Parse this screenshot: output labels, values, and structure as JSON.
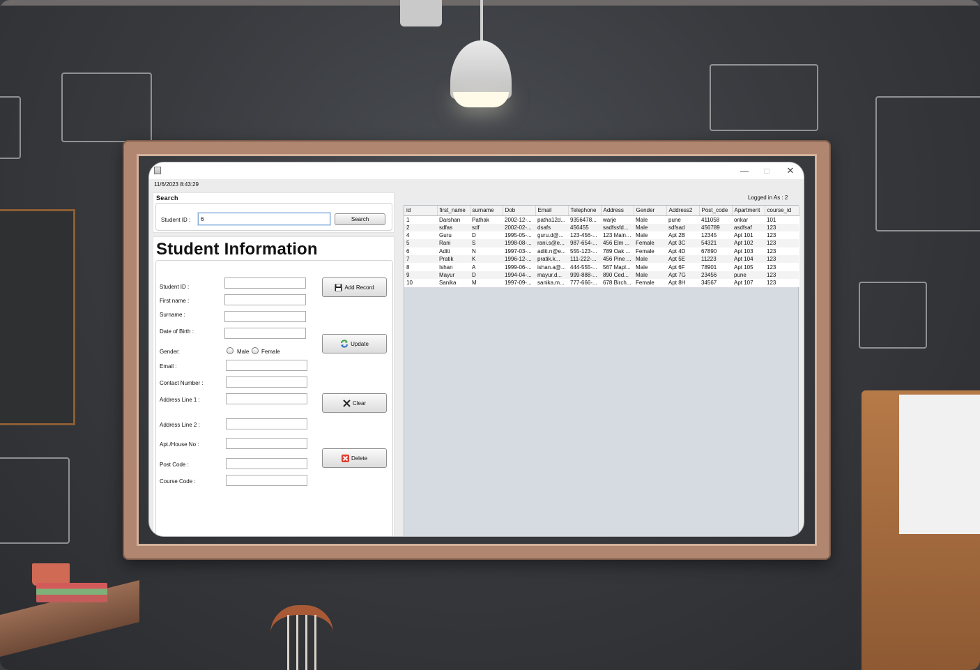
{
  "window": {
    "datetime": "11/6/2023  8:43:29",
    "controls": {
      "minimize": "—",
      "maximize": "□",
      "close": "✕"
    }
  },
  "search": {
    "title": "Search",
    "student_id_label": "Student ID :",
    "student_id_value": "6",
    "button_label": "Search"
  },
  "form": {
    "title": "Student Information",
    "labels": {
      "student_id": "Student ID :",
      "first_name": "First name :",
      "surname": "Surname :",
      "dob": "Date of Birth :",
      "gender": "Gender:",
      "email": "Email :",
      "contact": "Contact Number :",
      "address1": "Address Line 1 :",
      "address2": "Address Line 2 :",
      "apt": "Apt./House No :",
      "post_code": "Post Code :",
      "course_code": "Course Code :"
    },
    "gender_options": {
      "male": "Male",
      "female": "Female"
    },
    "buttons": {
      "add": "Add Record",
      "update": "Update",
      "clear": "Clear",
      "delete": "Delete"
    }
  },
  "status": {
    "logged_in": "Logged in As :  2"
  },
  "table": {
    "columns": [
      "id",
      "first_name",
      "surname",
      "Dob",
      "Email",
      "Telephone",
      "Address",
      "Gender",
      "Address2",
      "Post_code",
      "Apartment",
      "course_id"
    ],
    "rows": [
      [
        "1",
        "Darshan",
        "Pathak",
        "2002-12-...",
        "patha12d...",
        "9356478...",
        "warje",
        "Male",
        "pune",
        "411058",
        "onkar",
        "101"
      ],
      [
        "2",
        "sdfas",
        "sdf",
        "2002-02-...",
        "dsafs",
        "456455",
        "sadfssfd...",
        "Male",
        "sdfsad",
        "456789",
        "asdfsaf",
        "123"
      ],
      [
        "4",
        "Guru",
        "D",
        "1995-05-...",
        "guru.d@...",
        "123-456-...",
        "123 Main ...",
        "Male",
        "Apt 2B",
        "12345",
        "Apt 101",
        "123"
      ],
      [
        "5",
        "Rani",
        "S",
        "1998-08-...",
        "rani.s@e...",
        "987-654-...",
        "456 Elm ...",
        "Female",
        "Apt 3C",
        "54321",
        "Apt 102",
        "123"
      ],
      [
        "6",
        "Aditi",
        "N",
        "1997-03-...",
        "aditi.n@e...",
        "555-123-...",
        "789 Oak ...",
        "Female",
        "Apt 4D",
        "67890",
        "Apt 103",
        "123"
      ],
      [
        "7",
        "Pratik",
        "K",
        "1996-12-...",
        "pratik.k...",
        "111-222-...",
        "456 Pine ...",
        "Male",
        "Apt 5E",
        "11223",
        "Apt 104",
        "123"
      ],
      [
        "8",
        "Ishan",
        "A",
        "1999-06-...",
        "ishan.a@...",
        "444-555-...",
        "567 Mapl...",
        "Male",
        "Apt 6F",
        "78901",
        "Apt 105",
        "123"
      ],
      [
        "9",
        "Mayur",
        "D",
        "1994-04-...",
        "mayur.d...",
        "999-888-...",
        "890 Ced...",
        "Male",
        "Apt 7G",
        "23456",
        "pune",
        "123"
      ],
      [
        "10",
        "Sanika",
        "M",
        "1997-09-...",
        "sanika.m...",
        "777-666-...",
        "678 Birch...",
        "Female",
        "Apt 8H",
        "34567",
        "Apt 107",
        "123"
      ]
    ]
  },
  "icons": {
    "app": "java-app-icon",
    "add": "save-disk-icon",
    "update": "refresh-icon",
    "clear": "clear-x-icon",
    "delete": "delete-red-x-icon"
  },
  "colors": {
    "window_bg": "#ececec",
    "table_empty_bg": "#d6dae1",
    "focus_border": "#7aa7d9",
    "delete_red": "#e23b2e",
    "refresh_green": "#3aa34a",
    "refresh_blue": "#2f6fc1"
  }
}
